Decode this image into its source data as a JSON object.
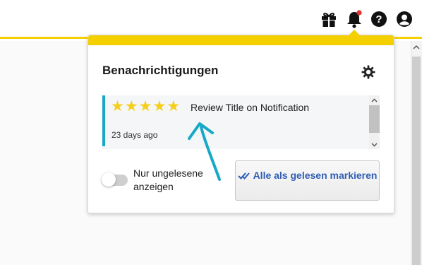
{
  "header": {
    "icons": [
      "gift-icon",
      "bell-icon",
      "help-icon",
      "account-icon"
    ],
    "accent_color": "#f5d000",
    "bell_badge_color": "#e03030"
  },
  "notifications_panel": {
    "title": "Benachrichtigungen",
    "settings_icon": "gear-icon",
    "items": [
      {
        "rating": 5,
        "star_glyph": "★",
        "title": "Review Title on Notification",
        "time": "23 days ago",
        "accent_color": "#17a8c8"
      }
    ],
    "unread_toggle": {
      "label": "Nur ungelesene anzeigen",
      "on": false
    },
    "mark_all_read_button": {
      "label": "Alle als gelesen markieren",
      "icon": "double-check-icon",
      "color": "#2f5db3"
    }
  },
  "annotation": {
    "icon": "curved-arrow-icon",
    "color": "#17a8c8"
  }
}
